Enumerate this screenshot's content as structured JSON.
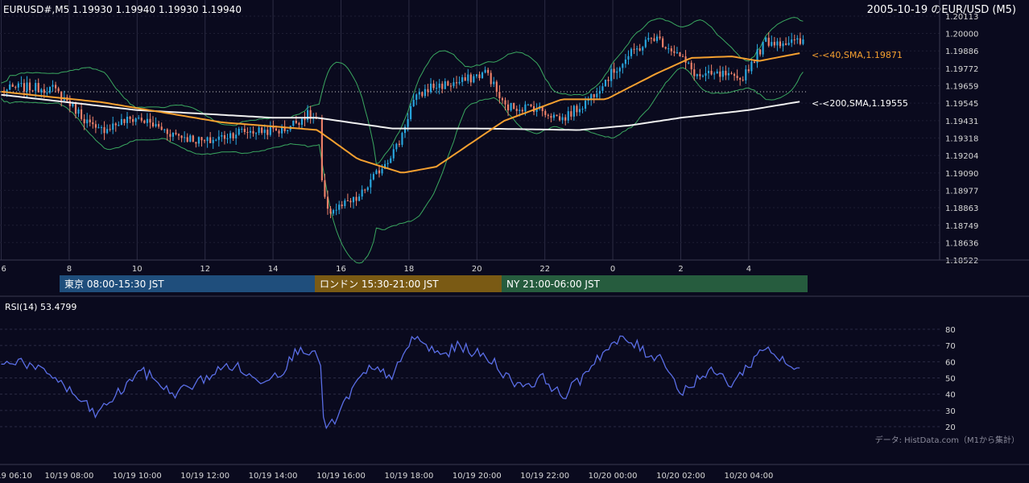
{
  "header": {
    "symbol_ohlc": "EURUSD#,M5 1.19930 1.19940 1.19930 1.19940",
    "title": "2005-10-19 のEUR/USD (M5)"
  },
  "sessions": [
    {
      "label": "東京 08:00-15:30 JST",
      "color": "#1f4e7c"
    },
    {
      "label": "ロンドン 15:30-21:00 JST",
      "color": "#7a5a14"
    },
    {
      "label": "NY 21:00-06:00 JST",
      "color": "#265c3e"
    }
  ],
  "price_ticks": [
    "1.20113",
    "1.20000",
    "1.19886",
    "1.19772",
    "1.19659",
    "1.19545",
    "1.19431",
    "1.19318",
    "1.19204",
    "1.19090",
    "1.18977",
    "1.18863",
    "1.18749",
    "1.18636",
    "1.18522"
  ],
  "hour_ticks": [
    "6",
    "8",
    "10",
    "12",
    "14",
    "16",
    "18",
    "20",
    "22",
    "0",
    "2",
    "4"
  ],
  "date_ticks": [
    "10/19 06:10",
    "10/19 08:00",
    "10/19 10:00",
    "10/19 12:00",
    "10/19 14:00",
    "10/19 16:00",
    "10/19 18:00",
    "10/19 20:00",
    "10/19 22:00",
    "10/20 00:00",
    "10/20 02:00",
    "10/20 04:00"
  ],
  "sma40_label": "<-<40,SMA,1.19871",
  "sma200_label": "<-<200,SMA,1.19555",
  "rsi_label": "RSI(14) 53.4799",
  "rsi_ticks": [
    "80",
    "70",
    "60",
    "50",
    "40",
    "30",
    "20"
  ],
  "source": "データ: HistData.com（M1から集計）",
  "colors": {
    "background": "#0a0a1e",
    "up": "#29a8e0",
    "down": "#f0826a",
    "sma40": "#f5a030",
    "sma200": "#f0f0f0",
    "bollinger": "#3aa860",
    "rsi": "#5a6ee6"
  },
  "chart_data": [
    {
      "type": "candlestick",
      "ylim": [
        1.18522,
        1.20113
      ],
      "reference_line": 1.19659,
      "keypoints_hour": [
        6,
        6.5,
        7.5,
        8,
        8.8,
        9.5,
        10,
        11,
        12,
        13,
        14.3,
        15,
        15.4,
        15.45,
        15.7,
        16.5,
        17.7,
        18.1,
        18.6,
        19.5,
        20.3,
        20.8,
        21.7,
        22.5,
        23.2,
        23.7,
        24.5,
        25.2,
        25.8,
        26.5,
        27.3,
        27.7,
        28.5,
        29.5
      ],
      "keypoints_close": [
        1.1962,
        1.1965,
        1.1964,
        1.1955,
        1.1936,
        1.1942,
        1.1945,
        1.1935,
        1.1929,
        1.1936,
        1.1937,
        1.1947,
        1.1942,
        1.1893,
        1.1884,
        1.1892,
        1.1928,
        1.1955,
        1.1965,
        1.1968,
        1.1975,
        1.1952,
        1.1952,
        1.1944,
        1.1955,
        1.1968,
        1.1986,
        1.1998,
        1.1989,
        1.1972,
        1.1973,
        1.1968,
        1.1995,
        1.1994
      ],
      "sma40_keypoints_hour": [
        6,
        9,
        12.5,
        15.3,
        16.5,
        17.8,
        18.8,
        20.8,
        22.5,
        23.8,
        25.3,
        26.3,
        27.5,
        28.3,
        29.5
      ],
      "sma40_keypoints": [
        1.1962,
        1.1955,
        1.1942,
        1.1937,
        1.1918,
        1.1909,
        1.1913,
        1.1943,
        1.1957,
        1.1957,
        1.1974,
        1.1984,
        1.1985,
        1.1982,
        1.19871
      ],
      "sma200_keypoints_hour": [
        6,
        10,
        14,
        15.3,
        17.5,
        20,
        23,
        24.5,
        26,
        28,
        29.5
      ],
      "sma200_keypoints": [
        1.196,
        1.195,
        1.1945,
        1.1945,
        1.1938,
        1.1938,
        1.1937,
        1.194,
        1.1945,
        1.195,
        1.19555
      ]
    },
    {
      "type": "line",
      "name": "RSI(14)",
      "ylim": [
        15,
        85
      ],
      "keypoints_hour": [
        6,
        6.5,
        7,
        7.5,
        8,
        8.5,
        8.8,
        9.3,
        9.7,
        10,
        10.5,
        11,
        11.5,
        12,
        12.7,
        13,
        13.5,
        14,
        14.3,
        14.8,
        15.2,
        15.4,
        15.5,
        15.8,
        16.3,
        16.8,
        17.5,
        17.8,
        18.1,
        18.6,
        19,
        19.5,
        20,
        20.5,
        21,
        21.5,
        22,
        22.5,
        23,
        23.5,
        24,
        24.3,
        24.7,
        25,
        25.5,
        26,
        26.5,
        27,
        27.5,
        28,
        28.5,
        29,
        29.5
      ],
      "keypoints_rsi": [
        57,
        62,
        55,
        52,
        42,
        33,
        27,
        38,
        45,
        55,
        50,
        40,
        44,
        50,
        58,
        56,
        48,
        52,
        55,
        70,
        64,
        60,
        18,
        22,
        42,
        55,
        52,
        60,
        76,
        68,
        64,
        70,
        65,
        60,
        48,
        46,
        50,
        38,
        48,
        62,
        70,
        74,
        70,
        65,
        62,
        40,
        50,
        54,
        46,
        58,
        70,
        60,
        53.4799
      ]
    }
  ]
}
